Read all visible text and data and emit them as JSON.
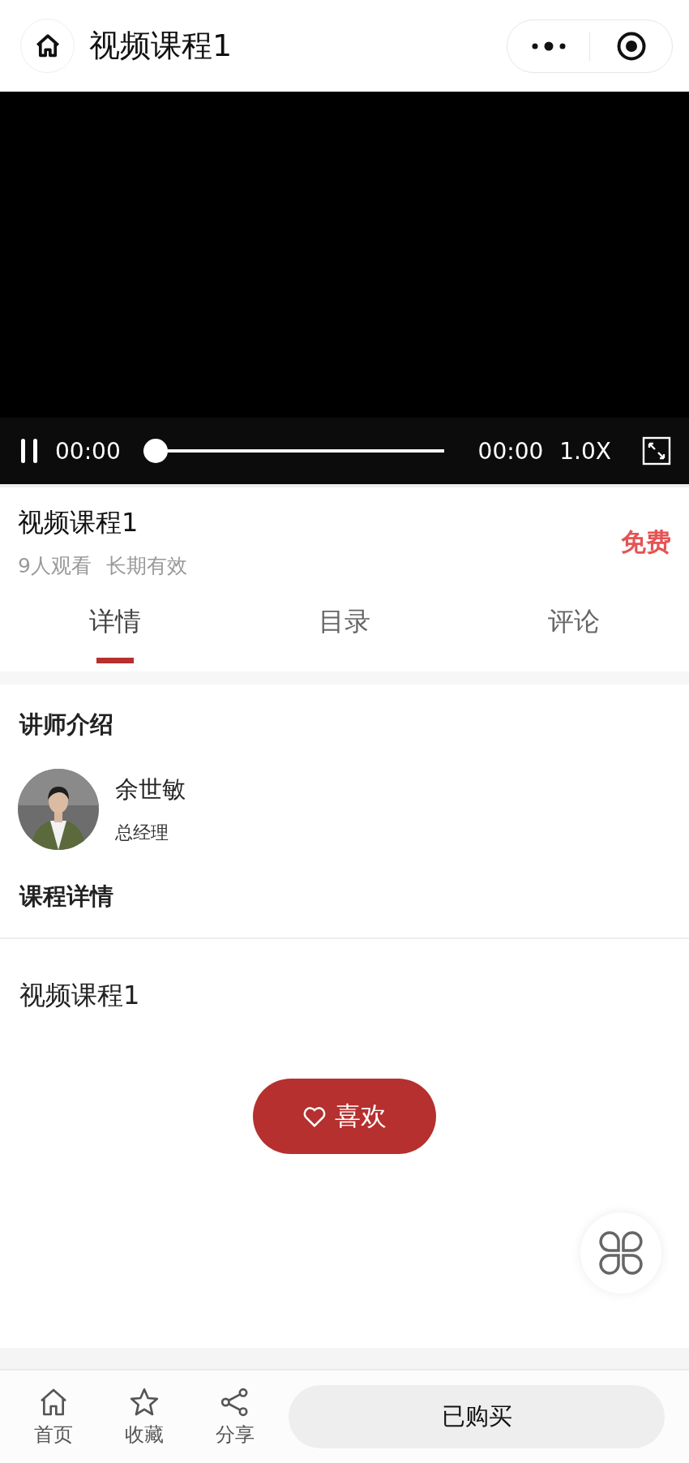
{
  "header": {
    "title": "视频课程1"
  },
  "player": {
    "playing": true,
    "current_time": "00:00",
    "duration": "00:00",
    "speed": "1.0X",
    "level": 0
  },
  "course": {
    "title": "视频课程1",
    "views": "9人观看",
    "validity": "长期有效",
    "price": "免费"
  },
  "tabs": [
    {
      "label": "详情",
      "selected": true
    },
    {
      "label": "目录",
      "selected": false
    },
    {
      "label": "评论",
      "selected": false
    }
  ],
  "instructor": {
    "heading": "讲师介绍",
    "name": "余世敏",
    "role": "总经理"
  },
  "details": {
    "heading": "课程详情",
    "body": "视频课程1"
  },
  "like_button": {
    "label": "喜欢"
  },
  "bottom_nav": [
    {
      "kind": "home",
      "label": "首页"
    },
    {
      "kind": "star",
      "label": "收藏"
    },
    {
      "kind": "share",
      "label": "分享"
    }
  ],
  "purchase_button": {
    "label": "已购买"
  }
}
